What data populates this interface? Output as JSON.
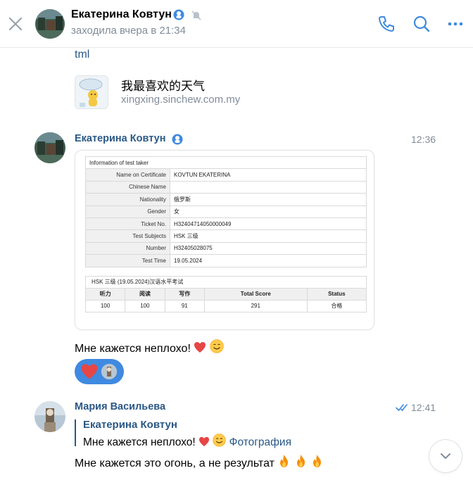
{
  "header": {
    "name": "Екатерина Ковтун",
    "status": "заходила вчера в 21:34"
  },
  "link_preview": {
    "url_fragment": "tml",
    "title": "我最喜欢的天气",
    "domain": "xingxing.sinchew.com.my"
  },
  "message1": {
    "author": "Екатерина Ковтун",
    "time": "12:36",
    "text": "Мне кажется неплохо!"
  },
  "certificate": {
    "caption": "Information of test taker",
    "rows": [
      {
        "label": "Name on Certificate",
        "value": "KOVTUN EKATERINA"
      },
      {
        "label": "Chinese Name",
        "value": ""
      },
      {
        "label": "Nationality",
        "value": "俄罗斯"
      },
      {
        "label": "Gender",
        "value": "女"
      },
      {
        "label": "Ticket No.",
        "value": "H32404714050000049"
      },
      {
        "label": "Test Subjects",
        "value": "HSK 三级"
      },
      {
        "label": "Number",
        "value": "H32405028075"
      },
      {
        "label": "Test Time",
        "value": "19.05.2024"
      }
    ],
    "score_caption": "HSK 三级 (19.05.2024)汉语水平考试",
    "score_headers": [
      "听力",
      "阅读",
      "写作",
      "Total Score",
      "Status"
    ],
    "score_values": [
      "100",
      "100",
      "91",
      "291",
      "合格"
    ]
  },
  "message2": {
    "author": "Мария Васильева",
    "time": "12:41",
    "reply_author": "Екатерина Ковтун",
    "reply_text": "Мне кажется неплохо!",
    "reply_link": "Фотография",
    "text": "Мне кажется это огонь,  а не результат"
  },
  "colors": {
    "link": "#2a5885",
    "secondary": "#818c99",
    "accent": "#3f8ae0",
    "heart": "#e64646"
  },
  "icons": [
    "close-icon",
    "verified-badge-icon",
    "mute-icon",
    "phone-icon",
    "search-icon",
    "more-icon",
    "double-check-icon",
    "chevron-down-icon",
    "heart-emoji",
    "smile-emoji",
    "fire-emoji"
  ]
}
